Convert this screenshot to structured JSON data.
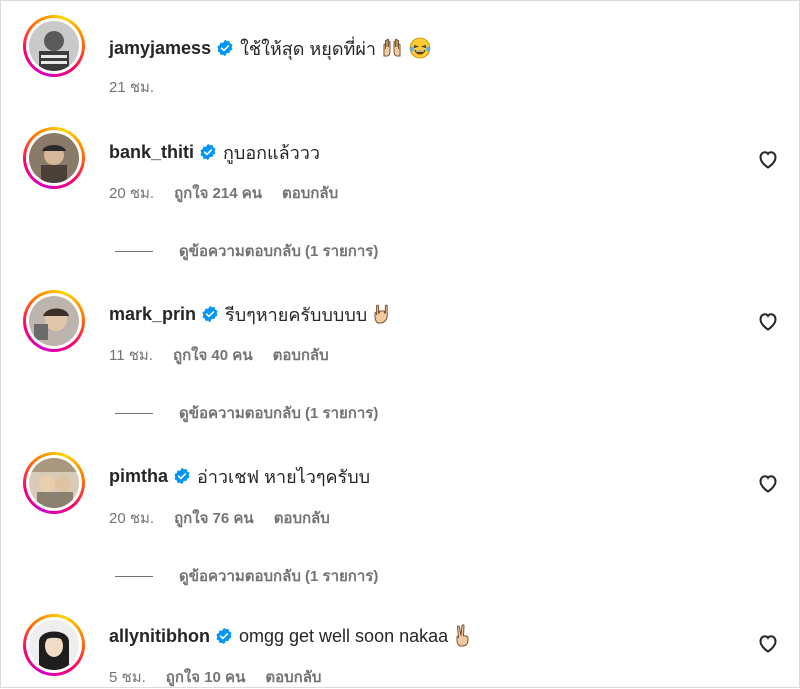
{
  "colors": {
    "text": "#262626",
    "secondary": "#737373",
    "verified": "#0095f6",
    "border": "#dbdbdb"
  },
  "comments": [
    {
      "username": "jamyjamess",
      "verified": true,
      "text": "ใช้ให้สุด หยุดที่ผ่า",
      "emojis": [
        "raised-hands-emoji",
        "laughing-tears-emoji"
      ],
      "time": "21 ชม.",
      "likes": "",
      "reply_label": "",
      "has_like_button": false,
      "view_replies": ""
    },
    {
      "username": "bank_thiti",
      "verified": true,
      "text": "กูบอกแล้ววว",
      "emojis": [],
      "time": "20 ชม.",
      "likes": "ถูกใจ 214 คน",
      "reply_label": "ตอบกลับ",
      "has_like_button": true,
      "view_replies": "ดูข้อความตอบกลับ (1 รายการ)"
    },
    {
      "username": "mark_prin",
      "verified": true,
      "text": "รีบๆหายครับบบบบ",
      "emojis": [
        "rock-hand-emoji"
      ],
      "time": "11 ชม.",
      "likes": "ถูกใจ 40 คน",
      "reply_label": "ตอบกลับ",
      "has_like_button": true,
      "view_replies": "ดูข้อความตอบกลับ (1 รายการ)"
    },
    {
      "username": "pimtha",
      "verified": true,
      "text": "อ่าวเชฟ หายไวๆครับบ",
      "emojis": [],
      "time": "20 ชม.",
      "likes": "ถูกใจ 76 คน",
      "reply_label": "ตอบกลับ",
      "has_like_button": true,
      "view_replies": "ดูข้อความตอบกลับ (1 รายการ)"
    },
    {
      "username": "allynitibhon",
      "verified": true,
      "text": "omgg get well soon nakaa",
      "emojis": [
        "victory-hand-emoji"
      ],
      "time": "5 ชม.",
      "likes": "ถูกใจ 10 คน",
      "reply_label": "ตอบกลับ",
      "has_like_button": true,
      "view_replies": ""
    }
  ]
}
